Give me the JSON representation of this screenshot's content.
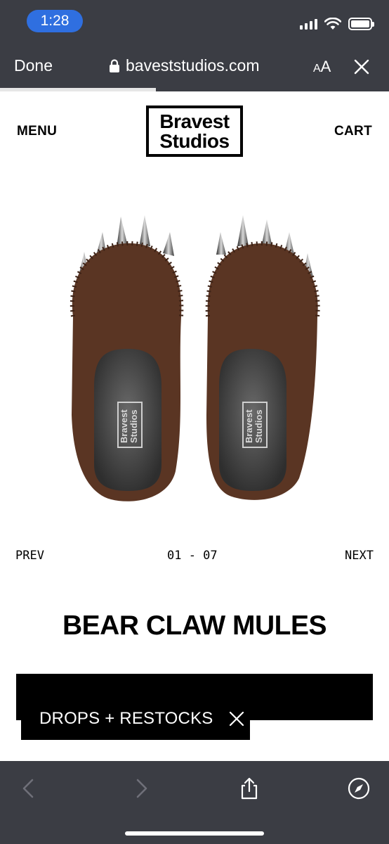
{
  "status_bar": {
    "time": "1:28"
  },
  "browser": {
    "done_label": "Done",
    "url": "baveststudios.com",
    "text_size_label_small": "A",
    "text_size_label_large": "A"
  },
  "header": {
    "menu_label": "MENU",
    "cart_label": "CART",
    "logo_line1": "Bravest",
    "logo_line2": "Studios"
  },
  "product": {
    "image_alt": "Bear Claw Mules",
    "insole_brand_line1": "Bravest",
    "insole_brand_line2": "Studios",
    "title": "BEAR CLAW MULES"
  },
  "slider": {
    "prev_label": "PREV",
    "counter": "01 - 07",
    "next_label": "NEXT"
  },
  "banner": {
    "label": "DROPS + RESTOCKS"
  },
  "colors": {
    "chrome": "#3b3d44",
    "time_pill": "#2f6fe0",
    "fur": "#5a3523"
  }
}
